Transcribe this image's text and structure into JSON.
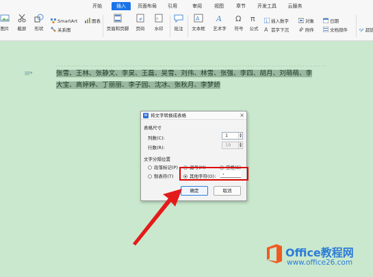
{
  "ribbon": {
    "tabs": [
      "开始",
      "插入",
      "页面布局",
      "引用",
      "审阅",
      "视图",
      "章节",
      "开发工具",
      "云服务"
    ],
    "active_tab": "插入",
    "tools": {
      "picture": "图片",
      "screenshot": "截屏",
      "shapes": "形状",
      "smartart": "SmartArt",
      "chart": "图表",
      "relation": "关系图",
      "header_footer": "页眉和页脚",
      "page_number": "页码",
      "watermark": "水印",
      "comment": "批注",
      "textbox": "文本框",
      "wordart": "艺术字",
      "symbol": "符号",
      "formula": "公式",
      "insert_number": "插入数字",
      "first_letter": "首字下沉",
      "object": "对象",
      "attachment": "附件",
      "date": "日期",
      "document_parts": "文档部件",
      "hyperlink": "超链接"
    }
  },
  "document": {
    "text": "张雪、王林、张静文、李昊、王磊、吴雪、刘伟、林雪、张强、李四、胡月、刘萌萌、李大宝、高婷婷、丁丽丽、李子园、沈冰、张秋月、李梦娇"
  },
  "dialog": {
    "title": "将文字转换成表格",
    "table_size_label": "表格尺寸",
    "columns_label": "列数(C):",
    "columns_value": "1",
    "rows_label": "行数(R):",
    "rows_value": "19",
    "separator_label": "文字分隔位置",
    "options": {
      "paragraph": "段落标记(P)",
      "comma": "逗号(M)",
      "space": "空格(S)",
      "tab": "制表符(T)",
      "other": "其他字符(O):"
    },
    "selected_option": "other",
    "other_char": "、",
    "ok_label": "确定",
    "cancel_label": "取消"
  },
  "watermark": {
    "title": "Office教程网",
    "url": "www.office26.com"
  },
  "colors": {
    "ribbon_accent": "#1a73e8",
    "page_background": "#c9e8cd",
    "highlight": "#d00000",
    "watermark_blue": "#2b7bd8",
    "watermark_orange": "#f05a22"
  }
}
